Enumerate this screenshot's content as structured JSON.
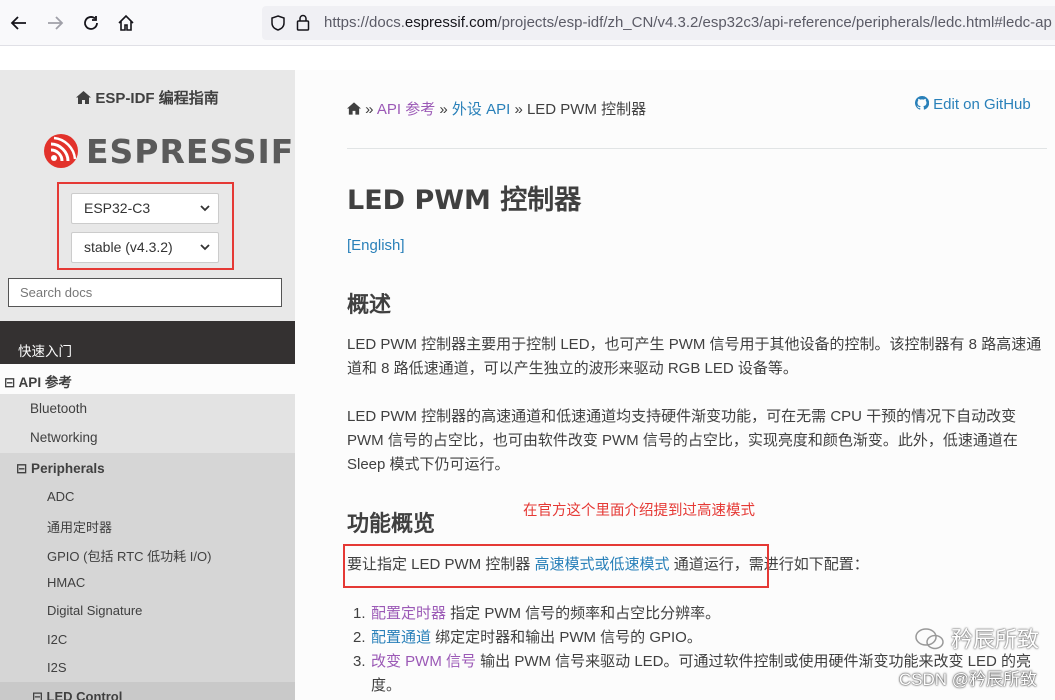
{
  "browser": {
    "url_prefix": "https://docs.",
    "url_domain": "espressif.com",
    "url_rest": "/projects/esp-idf/zh_CN/v4.3.2/esp32c3/api-reference/peripherals/ledc.html#ledc-ap"
  },
  "sidebar": {
    "project_title": "ESP-IDF 编程指南",
    "logo_text": "ESPRESSIF",
    "chip_select": "ESP32-C3",
    "version_select": "stable (v4.3.2)",
    "search_placeholder": "Search docs",
    "items": [
      {
        "label": "快速入门"
      },
      {
        "label": "⊟ API 参考"
      },
      {
        "label": "Bluetooth"
      },
      {
        "label": "Networking"
      },
      {
        "label": "⊟ Peripherals"
      },
      {
        "label": "ADC"
      },
      {
        "label": "通用定时器"
      },
      {
        "label": "GPIO (包括 RTC 低功耗 I/O)"
      },
      {
        "label": "HMAC"
      },
      {
        "label": "Digital Signature"
      },
      {
        "label": "I2C"
      },
      {
        "label": "I2S"
      },
      {
        "label": "⊟ LED Control"
      }
    ]
  },
  "content": {
    "breadcrumb": {
      "sep": "»",
      "item1": "API 参考",
      "item2": "外设 API",
      "current": "LED PWM 控制器"
    },
    "github_label": "Edit on GitHub",
    "title": "LED PWM 控制器",
    "english_link": "[English]",
    "section1": "概述",
    "para1": "LED PWM 控制器主要用于控制 LED，也可产生 PWM 信号用于其他设备的控制。该控制器有 8 路高速通道和 8 路低速通道，可以产生独立的波形来驱动 RGB LED 设备等。",
    "para2": "LED PWM 控制器的高速通道和低速通道均支持硬件渐变功能，可在无需 CPU 干预的情况下自动改变 PWM 信号的占空比，也可由软件改变 PWM 信号的占空比，实现亮度和颜色渐变。此外，低速通道在 Sleep 模式下仍可运行。",
    "section2": "功能概览",
    "annotation": "在官方这个里面介绍提到过高速模式",
    "para3_a": "要让指定 LED PWM 控制器 ",
    "para3_link": "高速模式或低速模式",
    "para3_b": " 通道运行，需进行如下配置：",
    "list": [
      {
        "num": "1.",
        "link": "配置定时器",
        "text": " 指定 PWM 信号的频率和占空比分辨率。"
      },
      {
        "num": "2.",
        "link": "配置通道",
        "text": " 绑定定时器和输出 PWM 信号的 GPIO。"
      },
      {
        "num": "3.",
        "link": "改变 PWM 信号",
        "text": " 输出 PWM 信号来驱动 LED。可通过软件控制或使用硬件渐变功能来改变 LED 的亮度。"
      }
    ]
  },
  "watermark": {
    "main": "矜辰所致",
    "csdn": "CSDN @矜辰所致"
  },
  "colors": {
    "sidebar_dark": "#343131",
    "link": "#2980b9",
    "visited": "#9b59b6",
    "annotation_red": "#e53935"
  }
}
